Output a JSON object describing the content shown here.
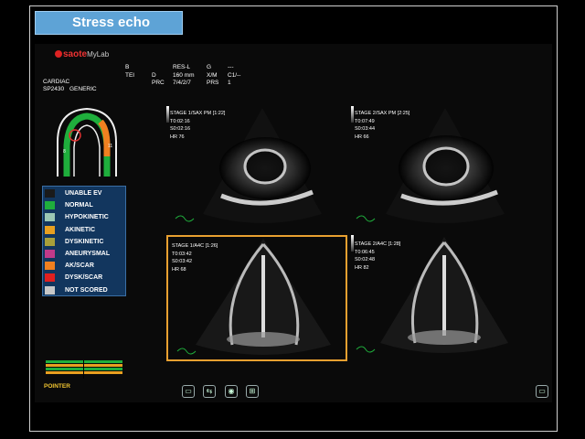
{
  "page": {
    "title": "Stress echo"
  },
  "logo": {
    "brand": "saote",
    "product": "MyLab"
  },
  "header": {
    "cardiac": "CARDIAC",
    "probe": "SP2430",
    "preset": "GENERIC"
  },
  "params": [
    [
      "B",
      "",
      "",
      ""
    ],
    [
      "TEI",
      "D",
      "X/M",
      "C1/--"
    ],
    [
      "",
      "PRC",
      "7/4/2/7",
      "PRS"
    ],
    [
      "",
      "RES-L",
      "G",
      "---"
    ],
    [
      "",
      "160 mm",
      "",
      "1"
    ]
  ],
  "param_cells": {
    "b": "B",
    "tei": "TEI",
    "res": "RES-L",
    "g": "G",
    "dash": "---",
    "d": "D",
    "mm": "160 mm",
    "xm": "X/M",
    "c1": "C1/--",
    "prc": "PRC",
    "prc_val": "7/4/2/7",
    "prs": "PRS",
    "one": "1"
  },
  "legend": [
    {
      "label": "UNABLE EV",
      "color": "#1a1a1a"
    },
    {
      "label": "NORMAL",
      "color": "#1fae3c"
    },
    {
      "label": "HYPOKINETIC",
      "color": "#9bc7b4"
    },
    {
      "label": "AKINETIC",
      "color": "#e8a020"
    },
    {
      "label": "DYSKINETIC",
      "color": "#a8a03a"
    },
    {
      "label": "ANEURYSMAL",
      "color": "#c03a8a"
    },
    {
      "label": "AK/SCAR",
      "color": "#f08020"
    },
    {
      "label": "DYSK/SCAR",
      "color": "#e02020"
    },
    {
      "label": "NOT SCORED",
      "color": "#c8c8c8"
    }
  ],
  "panes": [
    {
      "id": "stage1-sax",
      "l1": "STAGE 1/SAX PM [1:22]",
      "l2": "T0:02:16",
      "l3": "S0:02:16",
      "l4": "HR 76"
    },
    {
      "id": "stage2-sax",
      "l1": "STAGE 2/SAX PM [2:25]",
      "l2": "T0:07:49",
      "l3": "S0:03:44",
      "l4": "HR 66"
    },
    {
      "id": "stage1-a4c",
      "l1": "STAGE 1/A4C [1:26]",
      "l2": "T0:03:42",
      "l3": "S0:03:42",
      "l4": "HR 68"
    },
    {
      "id": "stage2-a4c",
      "l1": "STAGE 2/A4C [1:28]",
      "l2": "T0:06:45",
      "l3": "S0:02:48",
      "l4": "HR 82"
    }
  ],
  "pointer": "POINTER",
  "toolbar": {
    "icon1": "film-strip-icon",
    "icon2": "layout-switch-icon",
    "icon3": "disc-icon",
    "icon4": "network-icon",
    "icon5": "monitor-icon"
  }
}
